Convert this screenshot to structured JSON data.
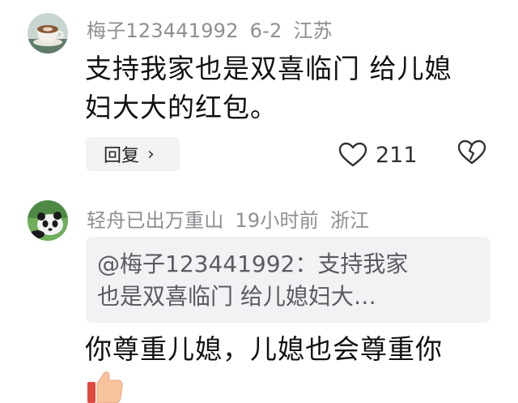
{
  "comments": [
    {
      "username": "梅子123441992",
      "date": "6-2",
      "location": "江苏",
      "text_line1": "支持我家也是双喜临门 给儿媳",
      "text_line2": "妇大大的红包。",
      "reply_label": "回复",
      "reply_chevron": "›",
      "like_count": "211",
      "avatar_icon": "coffee-cup-avatar",
      "like_icon": "heart-icon",
      "dislike_icon": "broken-heart-icon"
    },
    {
      "username": "轻舟已出万重山",
      "date": "19小时前",
      "location": "浙江",
      "quote_line1": "@梅子123441992：支持我家",
      "quote_line2": "也是双喜临门 给儿媳妇大…",
      "text": "你尊重儿媳，儿媳也会尊重你",
      "avatar_icon": "panda-avatar",
      "emoji_icon": "thumbs-up-icon"
    }
  ]
}
